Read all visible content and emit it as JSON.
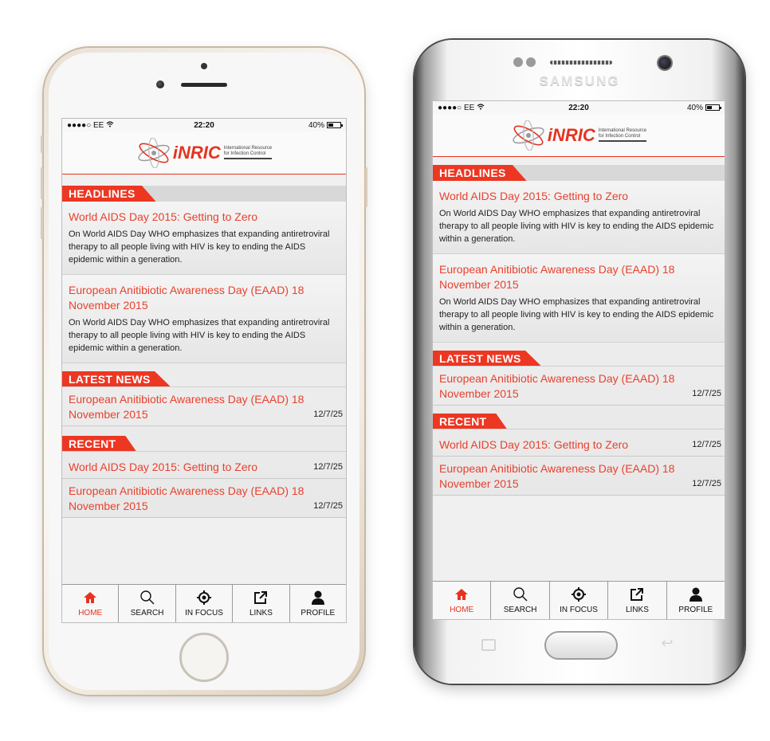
{
  "status": {
    "carrier": "●●●●○ EE",
    "time": "22:20",
    "battery": "40%"
  },
  "logo": {
    "name": "iNRIC",
    "tagline_1": "International Resource",
    "tagline_2": "for Infection Control"
  },
  "samsung_brand": "SAMSUNG",
  "sections": {
    "headlines": "HEADLINES",
    "latest_news": "LATEST NEWS",
    "recent": "RECENT"
  },
  "headlines": [
    {
      "title": "World AIDS Day 2015: Getting to Zero",
      "body": "On World AIDS Day WHO emphasizes that expanding antiretroviral therapy to all people living with HIV is key to ending the AIDS epidemic within a generation."
    },
    {
      "title": "European Anitibiotic Awareness Day (EAAD) 18 November 2015",
      "body": "On World AIDS Day WHO emphasizes that expanding antiretroviral therapy to all people living with HIV is key to ending the AIDS epidemic within a generation."
    }
  ],
  "latest_news": [
    {
      "title": "European Anitibiotic Awareness Day (EAAD) 18 November 2015",
      "date": "12/7/25"
    }
  ],
  "recent": [
    {
      "title": "World AIDS Day 2015: Getting to Zero",
      "date": "12/7/25"
    },
    {
      "title": "European Anitibiotic Awareness Day (EAAD) 18 November 2015",
      "date": "12/7/25"
    }
  ],
  "tabs": [
    {
      "label": "HOME",
      "icon": "home-icon",
      "active": true
    },
    {
      "label": "SEARCH",
      "icon": "search-icon",
      "active": false
    },
    {
      "label": "IN FOCUS",
      "icon": "focus-target-icon",
      "active": false
    },
    {
      "label": "LINKS",
      "icon": "external-link-icon",
      "active": false
    },
    {
      "label": "PROFILE",
      "icon": "profile-icon",
      "active": false
    }
  ],
  "colors": {
    "accent": "#e53320",
    "link": "#e8412e",
    "tab_active": "#e53320"
  }
}
